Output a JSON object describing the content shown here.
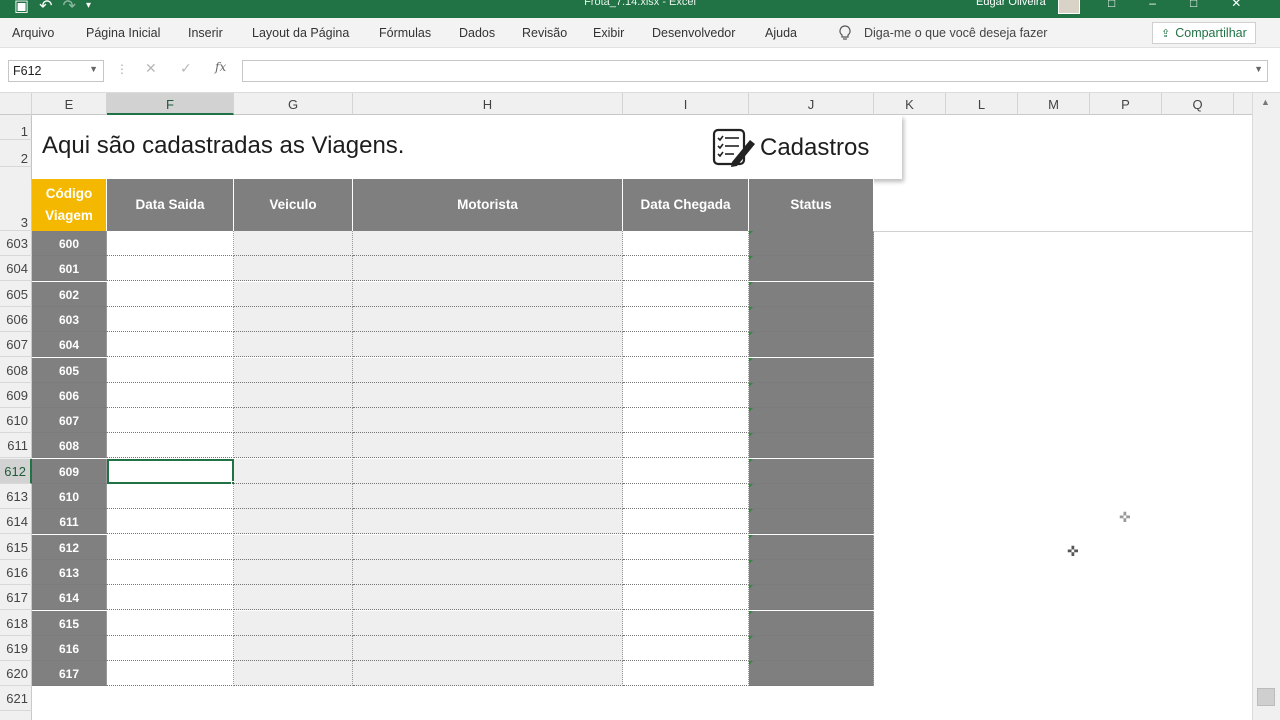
{
  "window": {
    "doc_title": "Frota_7.14.xlsx  -  Excel",
    "user_name": "Edgar Oliveira"
  },
  "ribbon": {
    "tabs": [
      "Arquivo",
      "Página Inicial",
      "Inserir",
      "Layout da Página",
      "Fórmulas",
      "Dados",
      "Revisão",
      "Exibir",
      "Desenvolvedor",
      "Ajuda"
    ],
    "tell_me": "Diga-me o que você deseja fazer",
    "share": "Compartilhar"
  },
  "formula_bar": {
    "name_box": "F612",
    "fx": "fx",
    "value": ""
  },
  "columns": [
    "E",
    "F",
    "G",
    "H",
    "I",
    "J",
    "K",
    "L",
    "M",
    "P",
    "Q"
  ],
  "selected_column": "F",
  "top_rows": [
    "1",
    "2",
    "3"
  ],
  "rows": [
    "603",
    "604",
    "605",
    "606",
    "607",
    "608",
    "609",
    "610",
    "611",
    "612",
    "613",
    "614",
    "615",
    "616",
    "617",
    "618",
    "619",
    "620",
    "621"
  ],
  "selected_row": "612",
  "banner": {
    "title": "Aqui são cadastradas as Viagens.",
    "cadastros": "Cadastros"
  },
  "table": {
    "headers": {
      "code_line1": "Código",
      "code_line2": "Viagem",
      "data_saida": "Data Saida",
      "veiculo": "Veiculo",
      "motorista": "Motorista",
      "data_chegada": "Data Chegada",
      "status": "Status"
    },
    "codes": [
      "600",
      "601",
      "602",
      "603",
      "604",
      "605",
      "606",
      "607",
      "608",
      "609",
      "610",
      "611",
      "612",
      "613",
      "614",
      "615",
      "616",
      "617"
    ],
    "active_code": "609"
  },
  "colors": {
    "excel_green": "#217346",
    "header_grey": "#7f7f7f",
    "code_header_yellow": "#f4b800"
  }
}
